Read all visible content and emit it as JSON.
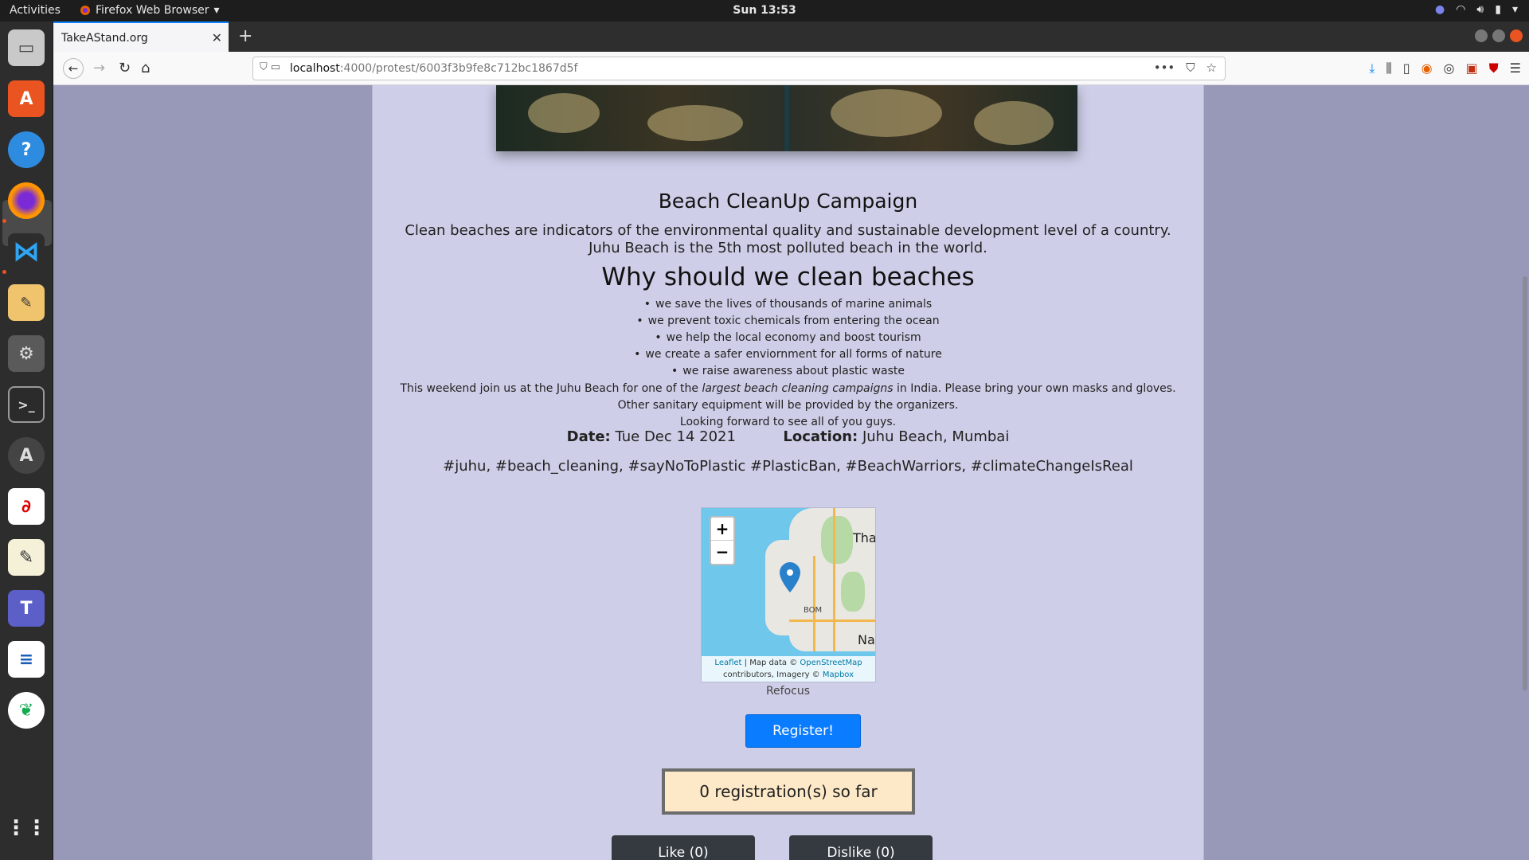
{
  "topbar": {
    "activities": "Activities",
    "app_menu": "Firefox Web Browser",
    "clock": "Sun 13:53"
  },
  "dock": {
    "items": [
      "files-icon",
      "app-center-icon",
      "help-icon",
      "firefox-icon",
      "vscode-icon",
      "drawing-app-icon",
      "settings-icon",
      "terminal-icon",
      "software-updater-icon",
      "pdf-viewer-icon",
      "text-editor-icon",
      "teams-icon",
      "writer-icon",
      "mongodb-compass-icon",
      "app-grid-icon"
    ]
  },
  "browser": {
    "tab_title": "TakeAStand.org",
    "url_host": "localhost",
    "url_rest": ":4000/protest/6003f3b9fe8c712bc1867d5f"
  },
  "page": {
    "title": "Beach CleanUp Campaign",
    "desc_line1": "Clean beaches are indicators of the environmental quality and sustainable development level of a country.",
    "desc_line2": "Juhu Beach is the 5th most polluted beach in the world.",
    "why_heading": "Why should we clean beaches",
    "bullets": [
      "we save the lives of thousands of marine animals",
      "we prevent toxic chemicals from entering the ocean",
      "we help the local economy and boost tourism",
      "we create a safer enviornment for all forms of nature",
      "we raise awareness about plastic waste"
    ],
    "join_prefix": "This weekend join us at the Juhu Beach for one of the ",
    "join_italic": "largest beach cleaning campaigns",
    "join_suffix": " in India. Please bring your own masks and gloves.",
    "join_line2": "Other sanitary equipment will be provided by the organizers.",
    "join_line3": "Looking forward to see all of you guys.",
    "date_label": "Date:",
    "date_value": "Tue Dec 14 2021",
    "location_label": "Location:",
    "location_value": "Juhu Beach, Mumbai",
    "tags": "#juhu, #beach_cleaning, #sayNoToPlastic #PlasticBan, #BeachWarriors, #climateChangeIsReal",
    "map": {
      "zoom_in": "+",
      "zoom_out": "−",
      "label_tha": "Tha",
      "label_na": "Na",
      "label_bom": "BOM",
      "attrib_leaflet": "Leaflet",
      "attrib_text1": " | Map data © ",
      "attrib_osm": "OpenStreetMap",
      "attrib_text2": "contributors, Imagery © ",
      "attrib_mapbox": "Mapbox"
    },
    "refocus": "Refocus",
    "register": "Register!",
    "registrations": "0 registration(s) so far",
    "like": "Like (0)",
    "dislike": "Dislike (0)"
  },
  "colors": {
    "page_bg": "#9898b8",
    "panel_bg": "#cecee8",
    "register_btn": "#0a7cff",
    "count_box": "#fde8c8",
    "vote_btn": "#343a40"
  }
}
